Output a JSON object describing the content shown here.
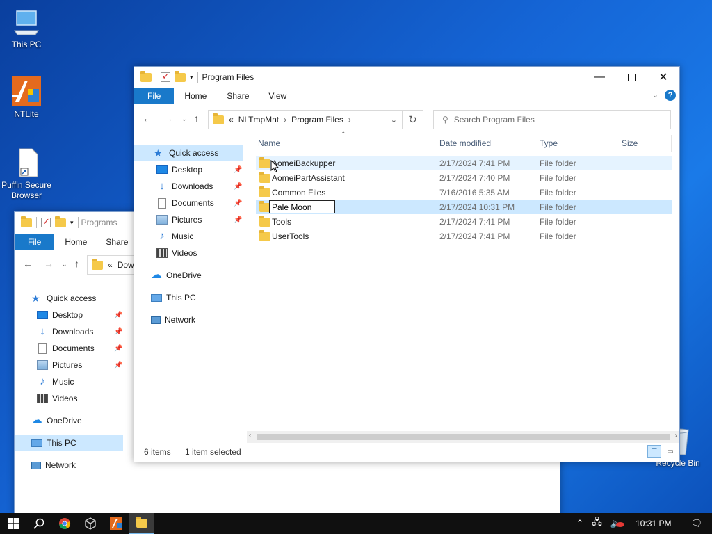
{
  "desktop": {
    "icons": [
      {
        "label": "This PC"
      },
      {
        "label": "NTLite"
      },
      {
        "label": "Puffin Secure Browser"
      },
      {
        "label": "Recycle Bin"
      }
    ]
  },
  "back_window": {
    "title": "Programs",
    "ribbon": {
      "file": "File",
      "home": "Home",
      "share": "Share"
    },
    "address": "Dow",
    "nav": [
      {
        "label": "Quick access",
        "icon": "star-icon"
      },
      {
        "label": "Desktop",
        "icon": "desktop-icon"
      },
      {
        "label": "Downloads",
        "icon": "downloads-icon"
      },
      {
        "label": "Documents",
        "icon": "documents-icon"
      },
      {
        "label": "Pictures",
        "icon": "pictures-icon"
      },
      {
        "label": "Music",
        "icon": "music-icon"
      },
      {
        "label": "Videos",
        "icon": "videos-icon"
      },
      {
        "label": "OneDrive",
        "icon": "cloud-icon"
      },
      {
        "label": "This PC",
        "icon": "computer-icon"
      },
      {
        "label": "Network",
        "icon": "network-icon"
      }
    ]
  },
  "front_window": {
    "title": "Program Files",
    "ribbon": {
      "file": "File",
      "home": "Home",
      "share": "Share",
      "view": "View"
    },
    "breadcrumb": {
      "prefix": "«",
      "part1": "NLTmpMnt",
      "part2": "Program Files"
    },
    "search_placeholder": "Search Program Files",
    "nav": [
      {
        "label": "Quick access"
      },
      {
        "label": "Desktop"
      },
      {
        "label": "Downloads"
      },
      {
        "label": "Documents"
      },
      {
        "label": "Pictures"
      },
      {
        "label": "Music"
      },
      {
        "label": "Videos"
      },
      {
        "label": "OneDrive"
      },
      {
        "label": "This PC"
      },
      {
        "label": "Network"
      }
    ],
    "columns": {
      "name": "Name",
      "date": "Date modified",
      "type": "Type",
      "size": "Size"
    },
    "files": [
      {
        "name": "AomeiBackupper",
        "date": "2/17/2024 7:41 PM",
        "type": "File folder"
      },
      {
        "name": "AomeiPartAssistant",
        "date": "2/17/2024 7:40 PM",
        "type": "File folder"
      },
      {
        "name": "Common Files",
        "date": "7/16/2016 5:35 AM",
        "type": "File folder"
      },
      {
        "name": "Pale Moon",
        "date": "2/17/2024 10:31 PM",
        "type": "File folder"
      },
      {
        "name": "Tools",
        "date": "2/17/2024 7:41 PM",
        "type": "File folder"
      },
      {
        "name": "UserTools",
        "date": "2/17/2024 7:41 PM",
        "type": "File folder"
      }
    ],
    "status": {
      "items": "6 items",
      "selected": "1 item selected"
    }
  },
  "taskbar": {
    "clock": "10:31 PM"
  },
  "colors": {
    "accent": "#1979ca",
    "selection": "#cce8ff",
    "hover": "#e5f3ff",
    "taskbar": "#101010"
  }
}
